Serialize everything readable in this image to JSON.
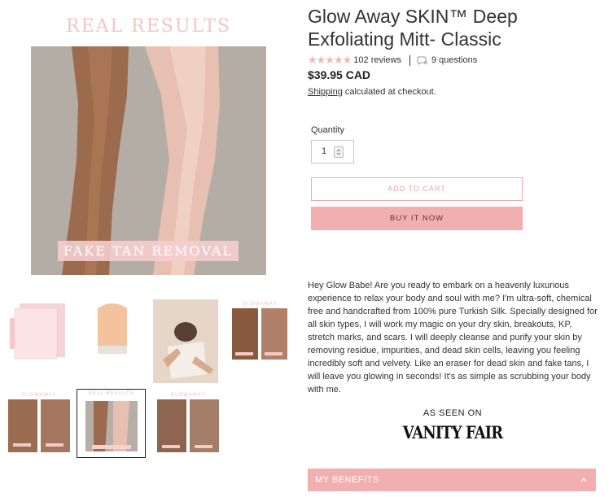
{
  "gallery": {
    "featured_caption_top": "REAL RESULTS",
    "featured_caption_bottom": "FAKE TAN REMOVAL",
    "thumbs": [
      {
        "kind": "packaging"
      },
      {
        "kind": "mitt"
      },
      {
        "kind": "model"
      },
      {
        "kind": "before-after",
        "label": "GLOWAWAY"
      },
      {
        "kind": "before-after",
        "label": "GLOWAWAY"
      },
      {
        "kind": "fake-tan-removal",
        "label": "REAL RESULTS",
        "active": true
      },
      {
        "kind": "before-after",
        "label": "GLOWAWAY"
      }
    ]
  },
  "product": {
    "title": "Glow Away SKIN™ Deep Exfoliating Mitt- Classic",
    "stars": "★★★★★",
    "reviews": "102 reviews",
    "questions": "9 questions",
    "price": "$39.95 CAD",
    "shipping_link": "Shipping",
    "shipping_text": " calculated at checkout."
  },
  "quantity": {
    "label": "Quantity",
    "value": "1"
  },
  "buttons": {
    "add_to_cart": "ADD TO CART",
    "buy_now": "BUY IT NOW"
  },
  "description": "Hey Glow Babe! Are you ready to embark on a heavenly luxurious experience to relax your body and soul with me? I'm ultra-soft, chemical free and handcrafted from 100% pure Turkish Silk. Specially designed for all skin types, I will work my magic on your dry skin, breakouts, KP, stretch marks, and scars. I will deeply cleanse and purify your skin by removing residue, impurities, and dead skin cells, leaving you feeling incredibly soft and velvety. Like an eraser for dead skin and fake tans, I will leave you glowing in seconds!  It's as simple as scrubbing your body with me.",
  "seen_on": {
    "label": "AS SEEN ON",
    "logo": "VANITY FAIR"
  },
  "benefits": {
    "label": "MY BENEFITS"
  },
  "colors": {
    "accent_pink": "#f2afaf",
    "star_pink": "#f5b3b3",
    "text": "#333333"
  }
}
